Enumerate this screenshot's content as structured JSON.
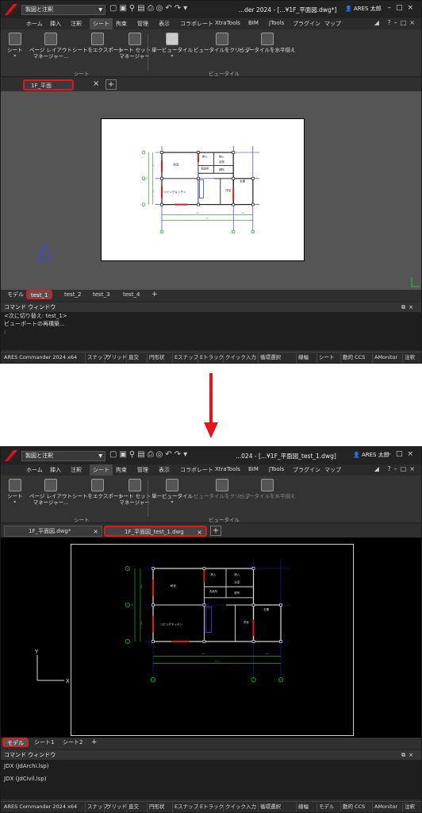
{
  "workspace": "製図と注釈",
  "user_name": "ARES 太郎",
  "app_version": "ARES Commander 2024 x64",
  "menus": [
    "ホーム",
    "挿入",
    "注釈",
    "シート",
    "拘束",
    "管理",
    "表示",
    "コラボレート",
    "XtraTools",
    "BIM",
    "JTools",
    "プラグイン",
    "マップ"
  ],
  "ribbon": {
    "sheet": "シート",
    "page_layout": "ページ レイアウト\nマネージャー...",
    "export_sheet": "シートをエクスポート",
    "sheet_set": "シート セット\nマネージャー",
    "single_viewport": "単一ビュータイル",
    "clip_viewport": "ビュータイルをクリップ",
    "align_viewport": "ビュータイルを水平揃え",
    "group_sheet": "シート",
    "group_viewport": "ビュータイル"
  },
  "before": {
    "doc_title": "...der 2024 - [...¥1F_平面図.dwg*]",
    "doc_tab": "1F_平面図.dwg*",
    "layout_tabs": [
      "モデル",
      "test_1",
      "test_2",
      "test_3",
      "test_4"
    ],
    "command_header": "コマンド ウィンドウ",
    "command_lines": [
      "<次に切り替え: test_1>",
      "ビューポートの再構築...",
      ":"
    ]
  },
  "after": {
    "doc_title": "...024 - [...¥1F_平面図_test_1.dwg]",
    "doc_tabs": [
      "1F_平面図.dwg*",
      "1F_平面図_test_1.dwg"
    ],
    "layout_tabs": [
      "モデル",
      "シート1",
      "シート2"
    ],
    "command_header": "コマンド ウィンドウ",
    "command_lines": [
      "JDX (JdArchi.lsp)",
      "JDX (JdCivil.lsp)"
    ]
  },
  "plan": {
    "rooms": [
      "和室",
      "リビングキッチン",
      "洋室",
      "押入",
      "物入",
      "洗面所",
      "浴室",
      "便所",
      "玄関"
    ],
    "grid_y": [
      "Y3",
      "Y2",
      "Y1"
    ],
    "grid_x": [
      "X1",
      "X2",
      "X3"
    ],
    "dims_left": [
      "3640",
      "7280",
      "3640"
    ],
    "dims_bottom": [
      "7280",
      "1820",
      "9100"
    ]
  },
  "status_items": [
    "スナップ",
    "グリッド",
    "直交",
    "円形状",
    "Eスナップ",
    "Eトラック",
    "クイック入力",
    "循環選択",
    "線幅",
    "シート",
    "動的 CCS",
    "AMonitor",
    "注釈"
  ],
  "status_items_after": [
    "スナップ",
    "グリッド",
    "直交",
    "円形状",
    "Eスナップ",
    "Eトラック",
    "クイック入力",
    "循環選択",
    "線幅",
    "モデル",
    "動的 CCS",
    "AMonitor",
    "注釈"
  ],
  "colors": {
    "highlight": "#e3171b",
    "arrow": "#e3171b",
    "grid_line": "#1a1acc",
    "wall_red": "#e3171b",
    "plan_green": "#18a018"
  }
}
